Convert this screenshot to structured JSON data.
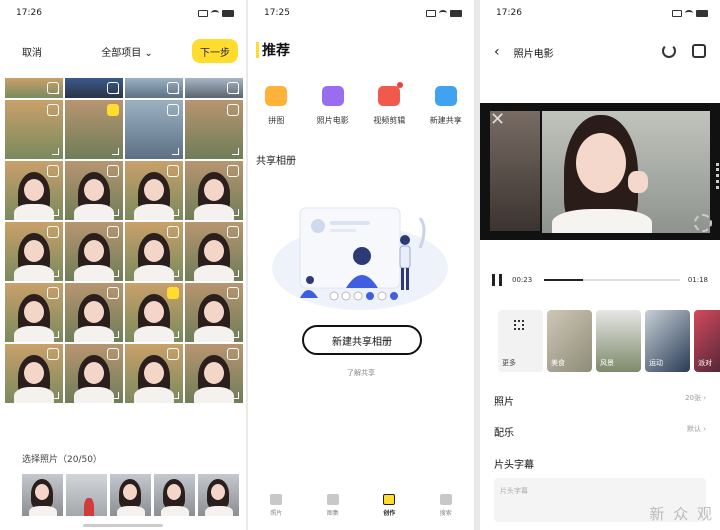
{
  "panel1": {
    "status_time": "17:26",
    "cancel_label": "取消",
    "album_label": "全部项目 ⌄",
    "next_label": "下一步",
    "selected_label": "选择照片（20/50）",
    "grid_bgs": [
      "bg-a",
      "bg-c",
      "bg-b",
      "bg-d"
    ],
    "checked_cells": [
      5,
      18
    ]
  },
  "panel2": {
    "status_time": "17:25",
    "title": "推荐",
    "tools": [
      {
        "label": "拼图",
        "color": "#ffb23a"
      },
      {
        "label": "照片电影",
        "color": "#9a6cf0"
      },
      {
        "label": "视频剪辑",
        "color": "#f0594b"
      },
      {
        "label": "新建共享",
        "color": "#3fa3f0"
      }
    ],
    "share_title": "共享相册",
    "new_album_btn": "新建共享相册",
    "learn_more": "了解共享",
    "tabs": [
      {
        "label": "照片",
        "active": false
      },
      {
        "label": "图集",
        "active": false
      },
      {
        "label": "创作",
        "active": true
      },
      {
        "label": "搜索",
        "active": false
      }
    ]
  },
  "panel3": {
    "status_time": "17:26",
    "title": "照片电影",
    "time_current": "00:23",
    "time_total": "01:18",
    "progress": 0.29,
    "filters": [
      {
        "label": "更多",
        "cls": "more"
      },
      {
        "label": "美食",
        "cls": "f-food"
      },
      {
        "label": "风景",
        "cls": "f-land"
      },
      {
        "label": "运动",
        "cls": "f-sport"
      },
      {
        "label": "派对",
        "cls": "f-party"
      }
    ],
    "photos_label": "照片",
    "photos_value": "20张 ›",
    "music_label": "配乐",
    "music_value": "默认 ›",
    "caption_label": "片头字幕",
    "caption_placeholder": "片头字幕",
    "watermark": "新 众 观"
  }
}
